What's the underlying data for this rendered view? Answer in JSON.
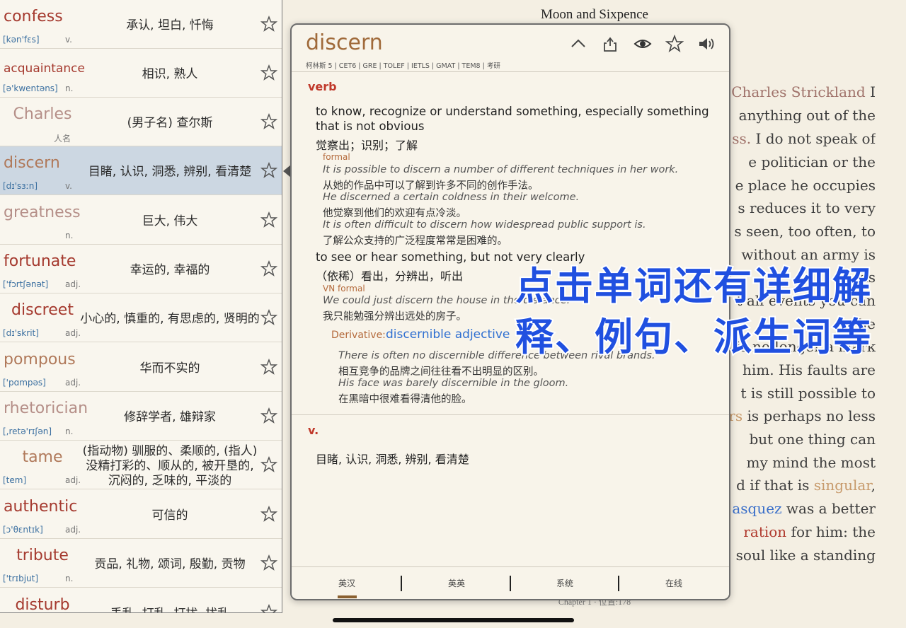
{
  "book": {
    "title": "Moon and Sixpence",
    "footer": "Chapter 1 · 位置:178",
    "lines": [
      [
        {
          "text": "Charles Strickland",
          "cls": "hl-brown"
        },
        {
          "text": " I"
        }
      ],
      [
        {
          "text": "anything out of the"
        }
      ],
      [
        {
          "text": "ss.",
          "cls": "hl-brown"
        },
        {
          "text": " I do not speak of"
        }
      ],
      [
        {
          "text": "e politician or the"
        }
      ],
      [
        {
          "text": "e place he occupies"
        }
      ],
      [
        {
          "text": "s reduces it to very"
        }
      ],
      [
        {
          "text": "s seen, too often, to"
        }
      ],
      [
        {
          "text": "without an army is"
        }
      ],
      [
        {
          "text": "as"
        }
      ],
      [
        {
          "text": "t all events you can"
        }
      ],
      [
        {
          "text": "he"
        }
      ],
      [
        {
          "text": "is no longer a mark"
        }
      ],
      [
        {
          "text": "him. His faults are"
        }
      ],
      [
        {
          "text": "t is still possible to"
        }
      ],
      [
        {
          "text": "rs",
          "cls": "hl-tan"
        },
        {
          "text": " is perhaps no less"
        }
      ],
      [
        {
          "text": "but one thing can"
        }
      ],
      [
        {
          "text": "my mind the most"
        }
      ],
      [
        {
          "text": "d if that is "
        },
        {
          "text": "singular",
          "cls": "hl-tan"
        },
        {
          "text": ","
        }
      ],
      [
        {
          "text": "asquez",
          "cls": "hl-blue"
        },
        {
          "text": " was a better"
        }
      ],
      [
        {
          "text": "ration",
          "cls": "hl-red"
        },
        {
          "text": " for him: the"
        }
      ],
      [
        {
          "text": "soul like a standing"
        }
      ]
    ]
  },
  "wordlist": [
    {
      "word": "confess",
      "phon": "[kən'fɛs]",
      "pos": "v.",
      "trans": "承认, 坦白, 忏悔"
    },
    {
      "word": "acquaintance",
      "phon": "[ə'kwentəns]",
      "pos": "n.",
      "trans": "相识, 熟人",
      "small": true
    },
    {
      "word": "Charles",
      "phon": "",
      "pos": "人名",
      "trans": "(男子名) 查尔斯",
      "faded": true,
      "center": true
    },
    {
      "word": "discern",
      "phon": "[dɪ'sɜːn]",
      "pos": "v.",
      "trans": "目睹, 认识, 洞悉, 辨别, 看清楚",
      "selected": true,
      "tan": true
    },
    {
      "word": "greatness",
      "phon": "",
      "pos": "n.",
      "trans": "巨大, 伟大",
      "faded": true
    },
    {
      "word": "fortunate",
      "phon": "['fɔrtʃənət]",
      "pos": "adj.",
      "trans": "幸运的, 幸福的"
    },
    {
      "word": "discreet",
      "phon": "[dɪ'skrit]",
      "pos": "adj.",
      "trans": "小心的, 慎重的, 有思虑的, 贤明的",
      "center": true
    },
    {
      "word": "pompous",
      "phon": "['pɑmpəs]",
      "pos": "adj.",
      "trans": "华而不实的",
      "tan": true
    },
    {
      "word": "rhetorician",
      "phon": "[,retə'rɪʃən]",
      "pos": "n.",
      "trans": "修辞学者, 雄辩家",
      "faded": true,
      "small2": true
    },
    {
      "word": "tame",
      "phon": "[tem]",
      "pos": "adj.",
      "trans": "(指动物) 驯服的、柔顺的, (指人) 没精打彩的、顺从的, 被开垦的, 沉闷的, 乏味的, 平淡的",
      "tan": true,
      "center": true
    },
    {
      "word": "authentic",
      "phon": "[ɔ'θɛntɪk]",
      "pos": "adj.",
      "trans": "可信的"
    },
    {
      "word": "tribute",
      "phon": "['trɪbjut]",
      "pos": "n.",
      "trans": "贡品, 礼物, 颂词, 殷勤, 贡物",
      "center": true
    },
    {
      "word": "disturb",
      "phon": "",
      "pos": "",
      "trans": "丢乱, 打乱, 打扰, 扰乱",
      "center": true
    }
  ],
  "popup": {
    "word": "discern",
    "tags": "柯林斯 5 | CET6 | GRE | TOLEF | IETLS | GMAT | TEM8 | 考研",
    "toolbar_icons": [
      "chevron-up-icon",
      "share-icon",
      "eye-icon",
      "star-icon",
      "speaker-icon"
    ],
    "sections": {
      "verb_label": "verb",
      "sense1_def1": "to know, recognize or understand something, especially something",
      "sense1_def2": "that is not obvious",
      "sense1_cn": "觉察出；识别；了解",
      "sense1_reg": "formal",
      "ex1_en": "It is possible to discern a number of different techniques in her work.",
      "ex1_cn": "从她的作品中可以了解到许多不同的创作手法。",
      "ex2_en": "He discerned a certain coldness in their welcome.",
      "ex2_cn": "他觉察到他们的欢迎有点冷淡。",
      "ex3_en": "It is often difficult to discern how widespread public support is.",
      "ex3_cn": "了解公众支持的广泛程度常常是困难的。",
      "sense2_def": "to see or hear something, but not very clearly",
      "sense2_cn": "（依稀）看出，分辨出，听出",
      "sense2_reg": "VN formal",
      "ex4_en": "We could just discern the house in the distance.",
      "ex4_cn": "我只能勉强分辨出远处的房子。",
      "deriv_label": "Derivative:",
      "deriv_word": "discernible adjective",
      "ex5_en": "There is often no discernible difference between rival brands.",
      "ex5_cn": "相互竞争的品牌之间往往看不出明显的区别。",
      "ex6_en": "His face was barely discernible in the gloom.",
      "ex6_cn": "在黑暗中很难看得清他的脸。",
      "v_label": "v.",
      "v_trans": "目睹, 认识, 洞悉, 辨别, 看清楚"
    },
    "tabs": [
      "英汉",
      "英英",
      "系统",
      "在线"
    ]
  },
  "caption": {
    "line1": "点击单词还有详细解",
    "line2": "释、例句、派生词等"
  },
  "colors": {
    "accent_red": "#a53a2f",
    "selected_row": "#ccd7e2",
    "caption_blue": "#2050e0"
  }
}
